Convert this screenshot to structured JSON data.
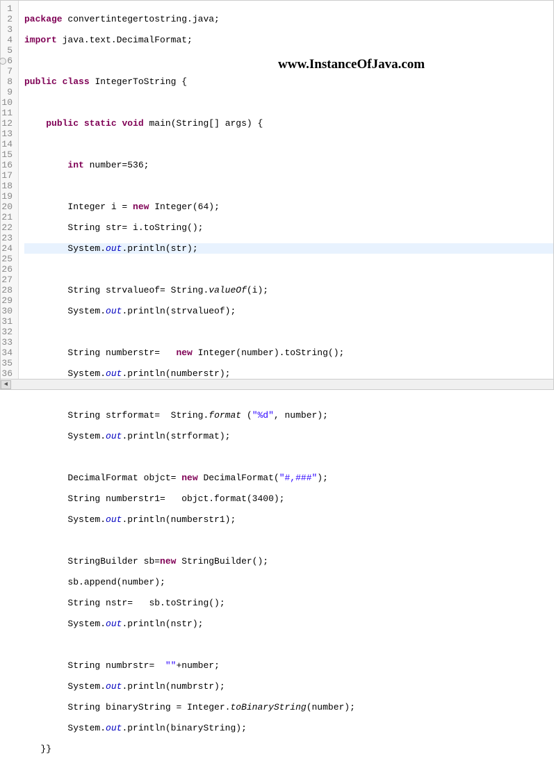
{
  "watermark": "www.InstanceOfJava.com",
  "lineNumbers": [
    "1",
    "2",
    "3",
    "4",
    "5",
    "6",
    "7",
    "8",
    "9",
    "10",
    "11",
    "12",
    "13",
    "14",
    "15",
    "16",
    "17",
    "18",
    "19",
    "20",
    "21",
    "22",
    "23",
    "24",
    "25",
    "26",
    "27",
    "28",
    "29",
    "30",
    "31",
    "32",
    "33",
    "34",
    "35",
    "36"
  ],
  "code": {
    "l1_kw1": "package",
    "l1_t1": " convertintegertostring.java;",
    "l2_kw1": "import",
    "l2_t1": " java.text.DecimalFormat;",
    "l4_kw1": "public",
    "l4_kw2": "class",
    "l4_t1": " IntegerToString {",
    "l6_kw1": "public",
    "l6_kw2": "static",
    "l6_kw3": "void",
    "l6_t1": " main(String[] args) {",
    "l8_kw1": "int",
    "l8_t1": " number=536;",
    "l10_t1": "Integer i = ",
    "l10_kw1": "new",
    "l10_t2": " Integer(64);",
    "l11_t1": "String str= i.toString();",
    "l12_t1": "System.",
    "l12_f1": "out",
    "l12_t2": ".println(str);",
    "l14_t1": "String strvalueof= String.",
    "l14_m1": "valueOf",
    "l14_t2": "(i);",
    "l15_t1": "System.",
    "l15_f1": "out",
    "l15_t2": ".println(strvalueof);",
    "l17_t1": "String numberstr=   ",
    "l17_kw1": "new",
    "l17_t2": " Integer(number).toString();",
    "l18_t1": "System.",
    "l18_f1": "out",
    "l18_t2": ".println(numberstr);",
    "l20_t1": "String strformat=  String.",
    "l20_m1": "format",
    "l20_t2": " (",
    "l20_s1": "\"%d\"",
    "l20_t3": ", number);",
    "l21_t1": "System.",
    "l21_f1": "out",
    "l21_t2": ".println(strformat);",
    "l23_t1": "DecimalFormat objct= ",
    "l23_kw1": "new",
    "l23_t2": " DecimalFormat(",
    "l23_s1": "\"#,###\"",
    "l23_t3": ");",
    "l24_t1": "String numberstr1=   objct.format(3400);",
    "l25_t1": "System.",
    "l25_f1": "out",
    "l25_t2": ".println(numberstr1);",
    "l27_t1": "StringBuilder sb=",
    "l27_kw1": "new",
    "l27_t2": " StringBuilder();",
    "l28_t1": "sb.append(number);",
    "l29_t1": "String nstr=   sb.toString();",
    "l30_t1": "System.",
    "l30_f1": "out",
    "l30_t2": ".println(nstr);",
    "l32_t1": "String numbrstr=  ",
    "l32_s1": "\"\"",
    "l32_t2": "+number;",
    "l33_t1": "System.",
    "l33_f1": "out",
    "l33_t2": ".println(numbrstr);",
    "l34_t1": "String binaryString = Integer.",
    "l34_m1": "toBinaryString",
    "l34_t2": "(number);",
    "l35_t1": "System.",
    "l35_f1": "out",
    "l35_t2": ".println(binaryString);",
    "l36_t1": "}}"
  },
  "scroll": {
    "left": "◄"
  }
}
